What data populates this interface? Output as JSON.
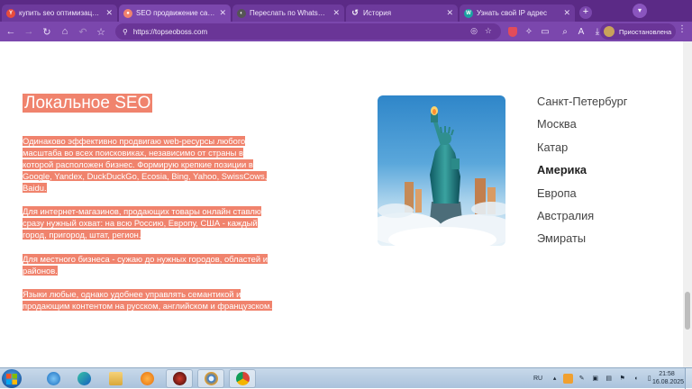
{
  "browser": {
    "tabs": [
      {
        "title": "купить seo оптимизация Мо",
        "favicon": "yandex-favicon",
        "color": "#e74c3c",
        "active": false
      },
      {
        "title": "SEO продвижение сайтов С",
        "favicon": "topseoboss-favicon",
        "color": "#f0836d",
        "active": true
      },
      {
        "title": "Переслать по WhatsApp",
        "favicon": "whatsapp-favicon",
        "color": "#555555",
        "active": false
      },
      {
        "title": "История",
        "favicon": "history-icon",
        "color": "#888888",
        "active": false
      },
      {
        "title": "Узнать свой IP адрес",
        "favicon": "ip-favicon",
        "color": "#1aa3a3",
        "active": false
      }
    ],
    "url": "https://topseoboss.com",
    "profile_label": "Приостановлена"
  },
  "page": {
    "heading": "Локальное SEO",
    "para1_a": "Одинаково эффективно продвигаю web-ресурсы любого масштаба во всех поисковиках, независимо от страны в которой расположен бизнес. Формирую крепкие позиции в ",
    "para1_link": "Google",
    "para1_b": ", Yandex, DuckDuckGo, Ecosia, Bing, Yahoo, SwissCows, Baidu.",
    "para2": "Для интернет-магазинов, продающих товары онлайн ставлю сразу нужный охват: на всю Россию, Европу, США - каждый город, пригород, штат, регион.",
    "para3": "Для местного бизнеса - сужаю до нужных городов, областей и районов.",
    "para4": "Языки любые, однако удобнее управлять семантикой и продающим контентом на русском, английском и французском.",
    "regions": [
      {
        "label": "Санкт-Петербург",
        "active": false
      },
      {
        "label": "Москва",
        "active": false
      },
      {
        "label": "Катар",
        "active": false
      },
      {
        "label": "Америка",
        "active": true
      },
      {
        "label": "Европа",
        "active": false
      },
      {
        "label": "Австралия",
        "active": false
      },
      {
        "label": "Эмираты",
        "active": false
      }
    ],
    "accent_color": "#f0836d"
  },
  "taskbar": {
    "language": "RU",
    "time": "21:58",
    "date": "16.08.2025"
  }
}
